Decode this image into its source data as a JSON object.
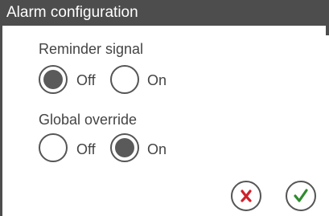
{
  "dialog": {
    "title": "Alarm configuration"
  },
  "groups": [
    {
      "label": "Reminder signal",
      "options": [
        {
          "label": "Off",
          "selected": true
        },
        {
          "label": "On",
          "selected": false
        }
      ]
    },
    {
      "label": "Global override",
      "options": [
        {
          "label": "Off",
          "selected": false
        },
        {
          "label": "On",
          "selected": true
        }
      ]
    }
  ],
  "actions": {
    "cancel_icon": "x-icon",
    "confirm_icon": "checkmark-icon"
  },
  "colors": {
    "title_bar": "#4d4d4d",
    "cancel": "#d0202a",
    "confirm": "#2e8b2e",
    "radio_fill": "#5a5a5a"
  }
}
